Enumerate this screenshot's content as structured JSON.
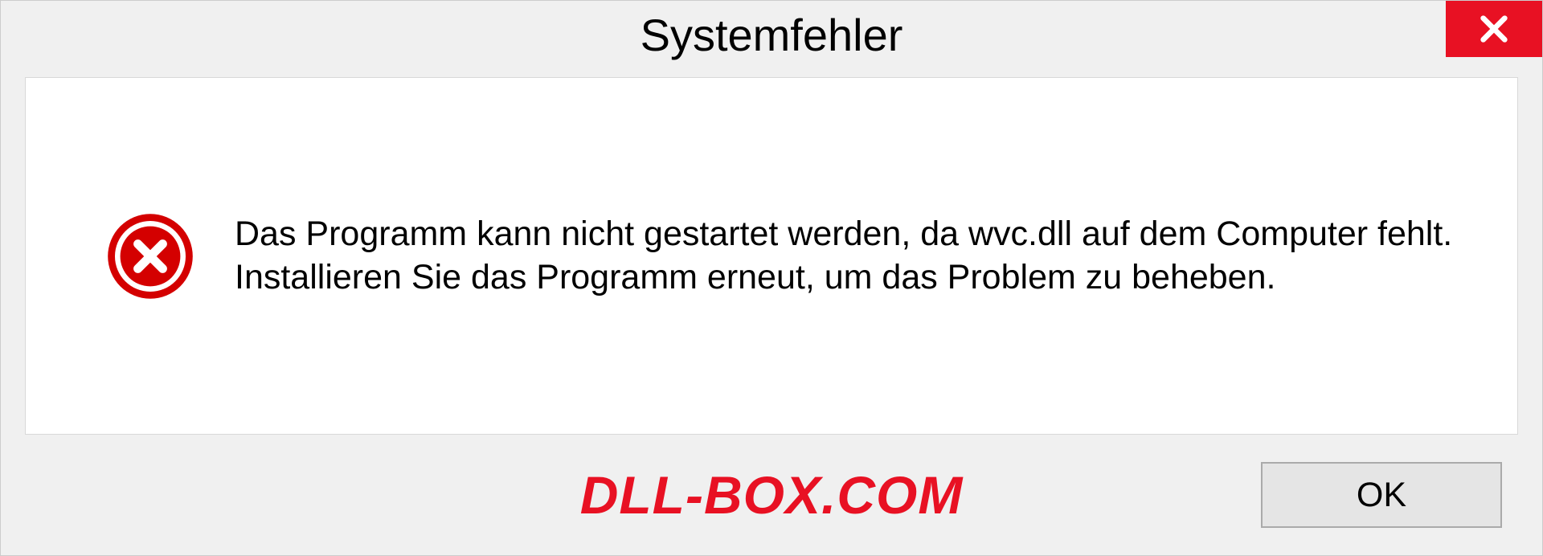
{
  "dialog": {
    "title": "Systemfehler",
    "message": "Das Programm kann nicht gestartet werden, da wvc.dll auf dem Computer fehlt. Installieren Sie das Programm erneut, um das Problem zu beheben.",
    "ok_label": "OK"
  },
  "watermark": "DLL-BOX.COM",
  "colors": {
    "close_red": "#e81123",
    "error_red": "#d40000"
  }
}
